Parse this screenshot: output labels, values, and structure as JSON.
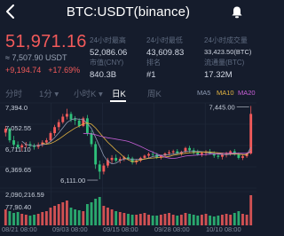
{
  "header": {
    "title": "BTC:USDT(binance)"
  },
  "quote": {
    "price": "51,971.16",
    "cny": "≈ 7,507.90 USDT",
    "change_abs": "+9,194.74",
    "change_pct": "+17.69%"
  },
  "stats": [
    {
      "label": "24小时最高",
      "value": "52,086.06"
    },
    {
      "label": "24小时最低",
      "value": "43,609.83"
    },
    {
      "label": "24小时成交量",
      "value": "33,423.50(BTC)"
    },
    {
      "label": "市值(CNY)",
      "value": "840.3B"
    },
    {
      "label": "排名",
      "value": "#1"
    },
    {
      "label": "流通量(BTC)",
      "value": "17.32M"
    }
  ],
  "tabs": [
    {
      "label": "分时"
    },
    {
      "label": "1分 ▾"
    },
    {
      "label": "小时K ▾"
    },
    {
      "label": "日K"
    },
    {
      "label": "周K"
    }
  ],
  "ma": [
    {
      "label": "MA5",
      "color": "#8f9bb3"
    },
    {
      "label": "MA10",
      "color": "#e3b341"
    },
    {
      "label": "MA20",
      "color": "#c860d8"
    }
  ],
  "colors": {
    "up": "#f25a5a",
    "down": "#2ec17a"
  },
  "chart_data": {
    "type": "candlestick",
    "price_labels": [
      "7,394.0",
      "7,052.55",
      "6,711.10",
      "6,369.65",
      "2,090,216.59",
      "77,90.40"
    ],
    "annotations": {
      "high": "7,445.00",
      "low": "6,111.00"
    },
    "x_labels": [
      "08/21 08:00",
      "09/03 08:00",
      "09/15 08:00",
      "09/28 08:00",
      "10/10 08:00"
    ],
    "ylim": [
      5950,
      7500
    ],
    "candles": [
      [
        6960,
        7080,
        6890,
        7030
      ],
      [
        7030,
        7050,
        6780,
        6820
      ],
      [
        6820,
        6900,
        6700,
        6740
      ],
      [
        6740,
        6800,
        6660,
        6690
      ],
      [
        6690,
        6760,
        6620,
        6730
      ],
      [
        6730,
        6790,
        6680,
        6750
      ],
      [
        6750,
        6800,
        6690,
        6720
      ],
      [
        6720,
        6760,
        6650,
        6700
      ],
      [
        6700,
        6780,
        6660,
        6740
      ],
      [
        6740,
        6820,
        6700,
        6780
      ],
      [
        6780,
        6860,
        6740,
        6820
      ],
      [
        6820,
        6980,
        6800,
        6950
      ],
      [
        6950,
        7100,
        6900,
        7060
      ],
      [
        7060,
        7200,
        7000,
        7150
      ],
      [
        7150,
        7300,
        7120,
        7250
      ],
      [
        7250,
        7394,
        7200,
        7300
      ],
      [
        7300,
        7340,
        7150,
        7200
      ],
      [
        7200,
        7260,
        7100,
        7180
      ],
      [
        7180,
        7220,
        7050,
        7080
      ],
      [
        7080,
        7250,
        7060,
        7220
      ],
      [
        7220,
        7280,
        6900,
        6950
      ],
      [
        6950,
        7000,
        6700,
        6750
      ],
      [
        6750,
        6800,
        6300,
        6380
      ],
      [
        6380,
        6450,
        6111,
        6250
      ],
      [
        6250,
        6400,
        6200,
        6360
      ],
      [
        6360,
        6500,
        6320,
        6460
      ],
      [
        6460,
        6550,
        6400,
        6500
      ],
      [
        6500,
        6560,
        6420,
        6450
      ],
      [
        6450,
        6520,
        6400,
        6480
      ],
      [
        6480,
        6540,
        6440,
        6510
      ],
      [
        6510,
        6560,
        6460,
        6490
      ],
      [
        6490,
        6520,
        6380,
        6420
      ],
      [
        6420,
        6480,
        6380,
        6450
      ],
      [
        6450,
        6520,
        6420,
        6500
      ],
      [
        6500,
        6560,
        6470,
        6540
      ],
      [
        6540,
        6600,
        6500,
        6570
      ],
      [
        6570,
        6620,
        6520,
        6560
      ],
      [
        6560,
        6590,
        6480,
        6510
      ],
      [
        6510,
        6560,
        6470,
        6540
      ],
      [
        6540,
        6600,
        6510,
        6580
      ],
      [
        6580,
        6640,
        6540,
        6600
      ],
      [
        6600,
        6650,
        6560,
        6620
      ],
      [
        6620,
        6660,
        6560,
        6580
      ],
      [
        6580,
        6630,
        6540,
        6610
      ],
      [
        6610,
        6700,
        6590,
        6680
      ],
      [
        6680,
        6720,
        6600,
        6640
      ],
      [
        6640,
        6680,
        6560,
        6600
      ],
      [
        6600,
        6650,
        6540,
        6560
      ],
      [
        6560,
        6620,
        6520,
        6590
      ],
      [
        6590,
        6640,
        6540,
        6610
      ],
      [
        6610,
        6660,
        6560,
        6580
      ],
      [
        6580,
        6620,
        6500,
        6540
      ],
      [
        6540,
        6590,
        6480,
        6520
      ],
      [
        6520,
        6580,
        6470,
        6560
      ],
      [
        6560,
        6610,
        6510,
        6590
      ],
      [
        6590,
        6640,
        6540,
        6620
      ],
      [
        6620,
        6660,
        6540,
        6560
      ],
      [
        6560,
        6600,
        6470,
        6500
      ],
      [
        6500,
        6560,
        6460,
        6530
      ],
      [
        6530,
        6600,
        6500,
        6580
      ],
      [
        6580,
        7445,
        6560,
        7300
      ]
    ],
    "volume": [
      18,
      16,
      14,
      15,
      13,
      12,
      11,
      12,
      13,
      15,
      16,
      20,
      22,
      24,
      26,
      28,
      20,
      18,
      17,
      16,
      24,
      26,
      30,
      32,
      22,
      20,
      18,
      16,
      15,
      14,
      13,
      12,
      12,
      13,
      14,
      12,
      11,
      11,
      12,
      13,
      14,
      12,
      11,
      12,
      14,
      13,
      12,
      11,
      12,
      13,
      11,
      10,
      11,
      12,
      13,
      12,
      14,
      16,
      13,
      12,
      34
    ]
  }
}
